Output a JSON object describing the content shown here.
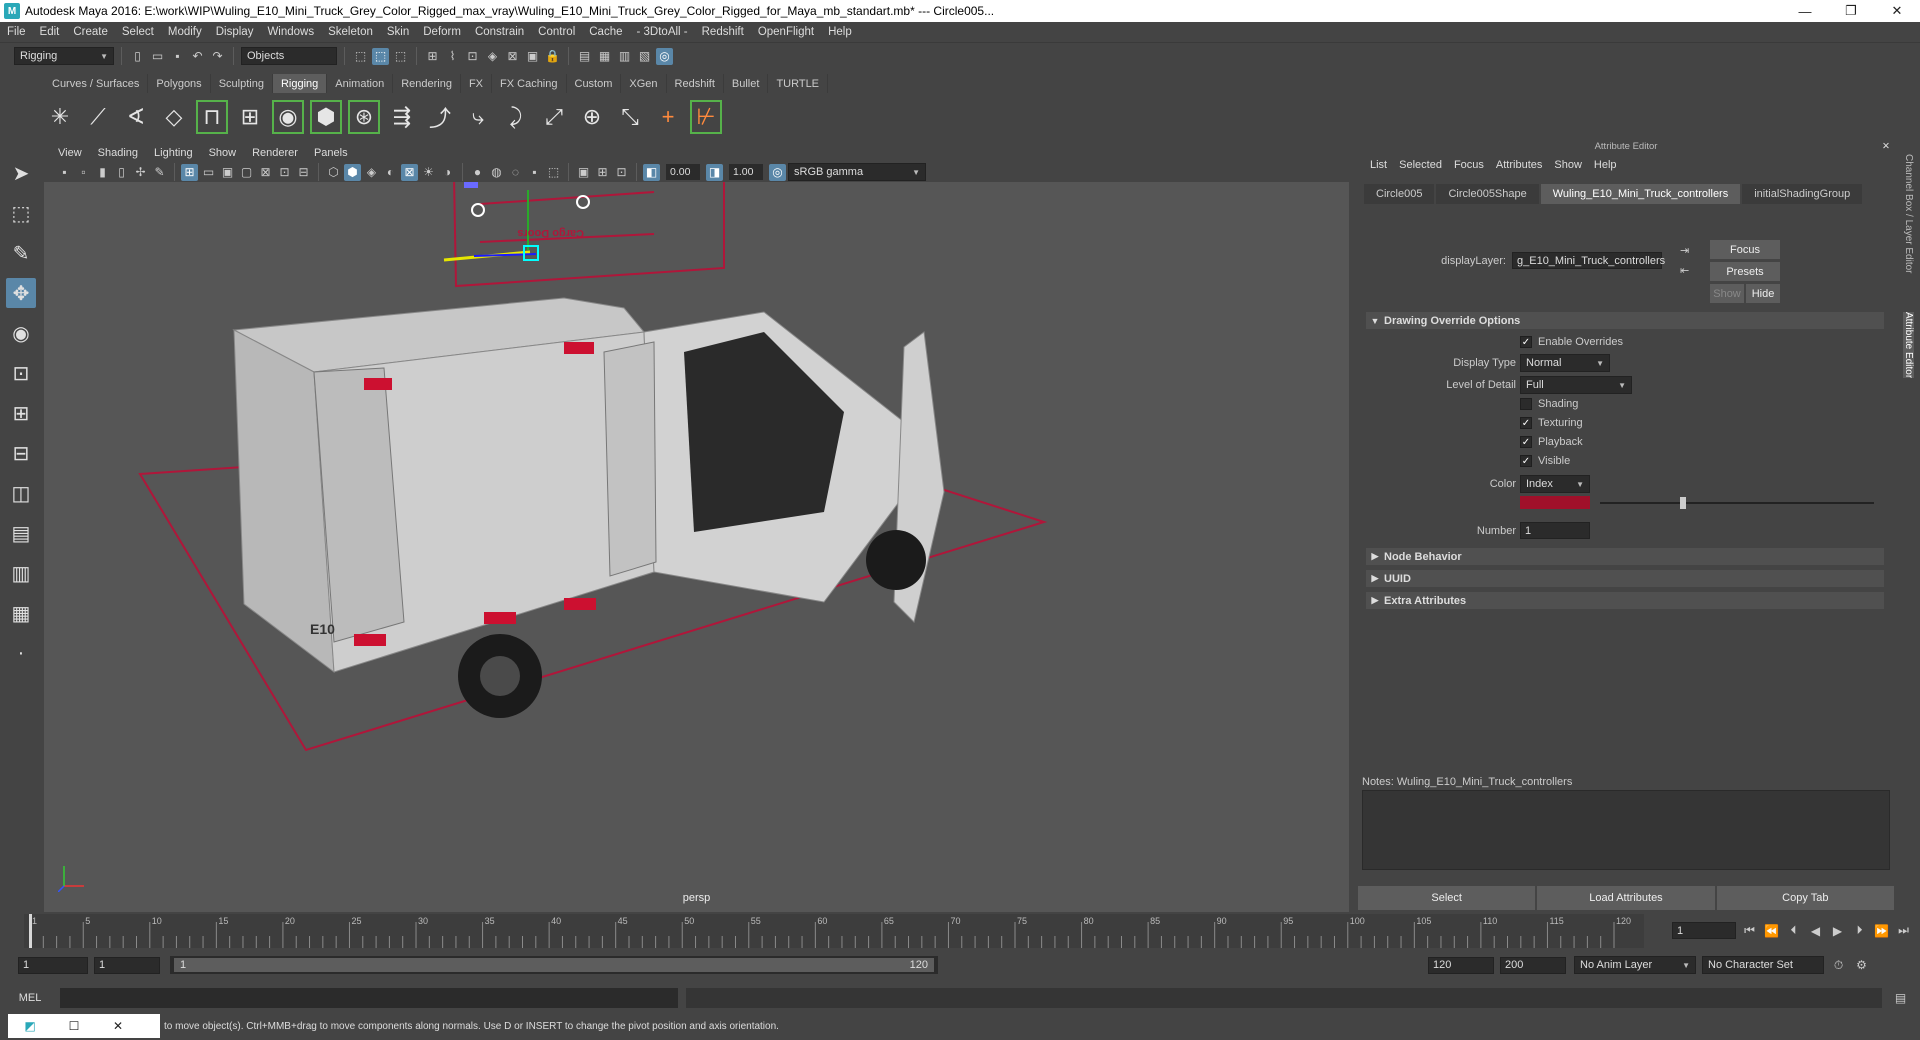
{
  "window": {
    "title": "Autodesk Maya 2016: E:\\work\\WIP\\Wuling_E10_Mini_Truck_Grey_Color_Rigged_max_vray\\Wuling_E10_Mini_Truck_Grey_Color_Rigged_for_Maya_mb_standart.mb*   ---   Circle005...",
    "controls": [
      "—",
      "❐",
      "✕"
    ]
  },
  "menubar": [
    "File",
    "Edit",
    "Create",
    "Select",
    "Modify",
    "Display",
    "Windows",
    "Skeleton",
    "Skin",
    "Deform",
    "Constrain",
    "Control",
    "Cache",
    "- 3DtoAll -",
    "Redshift",
    "OpenFlight",
    "Help"
  ],
  "statusline": {
    "mode": "Rigging",
    "selection_mask": "Objects"
  },
  "shelf_tabs": [
    "Curves / Surfaces",
    "Polygons",
    "Sculpting",
    "Rigging",
    "Animation",
    "Rendering",
    "FX",
    "FX Caching",
    "Custom",
    "XGen",
    "Redshift",
    "Bullet",
    "TURTLE"
  ],
  "active_shelf_tab": "Rigging",
  "viewport": {
    "menu": [
      "View",
      "Shading",
      "Lighting",
      "Show",
      "Renderer",
      "Panels"
    ],
    "exposure": "0.00",
    "gamma": "1.00",
    "color_space": "sRGB gamma",
    "camera_label": "persp",
    "decal_text_1": "E10",
    "controller_text": "Cargo Doors"
  },
  "attribute_editor": {
    "title": "Attribute Editor",
    "menu": [
      "List",
      "Selected",
      "Focus",
      "Attributes",
      "Show",
      "Help"
    ],
    "tabs": [
      "Circle005",
      "Circle005Shape",
      "Wuling_E10_Mini_Truck_controllers",
      "initialShadingGroup"
    ],
    "active_tab": "Wuling_E10_Mini_Truck_controllers",
    "display_layer_label": "displayLayer:",
    "display_layer_value": "g_E10_Mini_Truck_controllers",
    "focus_button": "Focus",
    "presets_button": "Presets",
    "show_button": "Show",
    "hide_button": "Hide",
    "section_drawing": "Drawing Override Options",
    "enable_overrides": "Enable Overrides",
    "display_type_label": "Display Type",
    "display_type_value": "Normal",
    "lod_label": "Level of Detail",
    "lod_value": "Full",
    "shading": "Shading",
    "texturing": "Texturing",
    "playback": "Playback",
    "visible": "Visible",
    "color_label": "Color",
    "color_mode": "Index",
    "color_swatch": "#a0102a",
    "color_index_fraction": 0.3,
    "number_label": "Number",
    "number_value": "1",
    "section_node_behavior": "Node Behavior",
    "section_uuid": "UUID",
    "section_extra": "Extra Attributes",
    "notes_label": "Notes:  Wuling_E10_Mini_Truck_controllers",
    "buttons": [
      "Select",
      "Load Attributes",
      "Copy Tab"
    ]
  },
  "right_strip": [
    "Channel Box / Layer Editor",
    "Attribute Editor"
  ],
  "timeline": {
    "ticks": [
      "1",
      "5",
      "10",
      "15",
      "20",
      "25",
      "30",
      "35",
      "40",
      "45",
      "50",
      "55",
      "60",
      "65",
      "70",
      "75",
      "80",
      "85",
      "90",
      "95",
      "100",
      "105",
      "110",
      "115",
      "120"
    ],
    "current_frame": "1"
  },
  "range": {
    "start": "1",
    "playback_start": "1",
    "slider_start": "1",
    "slider_end": "120",
    "playback_end": "120",
    "end": "200",
    "anim_layer": "No Anim Layer",
    "character_set": "No Character Set"
  },
  "command_line": {
    "label": "MEL"
  },
  "help_line": "to move object(s). Ctrl+MMB+drag to move components along normals. Use D or INSERT to change the pivot position and axis orientation."
}
